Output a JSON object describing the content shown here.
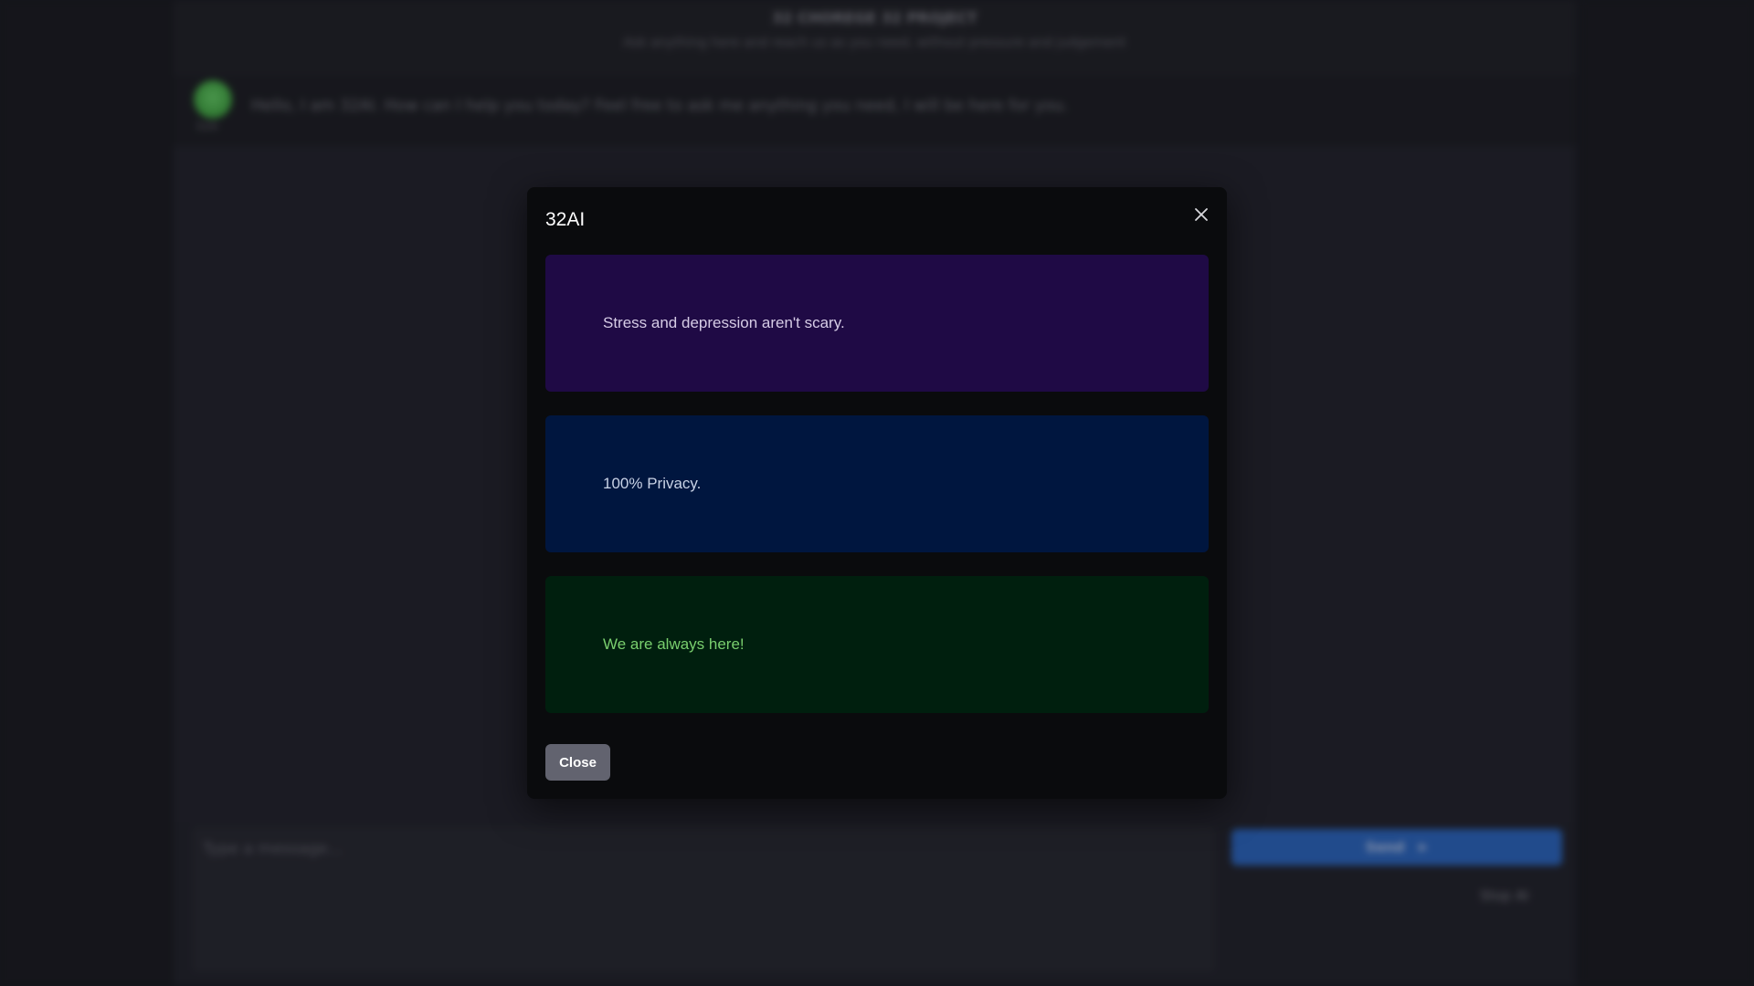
{
  "background": {
    "header": {
      "title": "32 CHOREGE 32 PROJECT",
      "subtitle": "Ask anything here and reach us as you need, without pressure and judgement"
    },
    "message": {
      "avatar_label": "32AI",
      "text": "Hello, I am 32AI. How can I help you today? Feel free to ask me anything you need, I will be here for you."
    },
    "input_placeholder": "Type a message...",
    "send_label": "Send",
    "stop_label": "Stop AI"
  },
  "modal": {
    "title": "32AI",
    "cards": [
      {
        "text": "Stress and depression aren't scary."
      },
      {
        "text": "100% Privacy."
      },
      {
        "text": "We are always here!"
      }
    ],
    "close_button_label": "Close",
    "close_icon": "close-icon"
  },
  "colors": {
    "card_purple": "#1f0a45",
    "card_blue": "#00163f",
    "card_green": "#001f0e",
    "green_text": "#79cf6e",
    "close_button": "#62636f",
    "send_button": "#2f6fd0"
  }
}
